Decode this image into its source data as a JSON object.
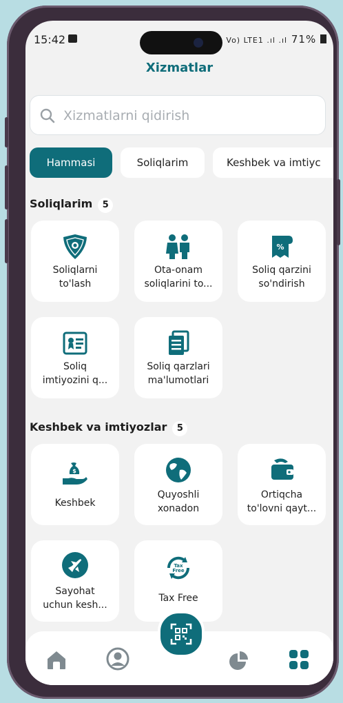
{
  "status": {
    "time": "15:42",
    "icons": "Vo) LTE1 .ıl .ıl",
    "battery": "71%"
  },
  "header": {
    "title": "Xizmatlar"
  },
  "search": {
    "placeholder": "Xizmatlarni qidirish"
  },
  "tabs": [
    {
      "label": "Hammasi",
      "active": true
    },
    {
      "label": "Soliqlarim",
      "active": false
    },
    {
      "label": "Keshbek va imtiyc",
      "active": false
    }
  ],
  "sections": [
    {
      "title": "Soliqlarim",
      "count": "5",
      "items": [
        {
          "line1": "Soliqlarni",
          "line2": "to'lash",
          "icon": "emblem-icon"
        },
        {
          "line1": "Ota-onam",
          "line2": "soliqlarini to...",
          "icon": "parents-icon"
        },
        {
          "line1": "Soliq qarzini",
          "line2": "so'ndirish",
          "icon": "receipt-percent-icon"
        },
        {
          "line1": "Soliq",
          "line2": "imtiyozini q...",
          "icon": "certificate-icon"
        },
        {
          "line1": "Soliq qarzlari",
          "line2": "ma'lumotlari",
          "icon": "documents-icon"
        }
      ]
    },
    {
      "title": "Keshbek va imtiyozlar",
      "count": "5",
      "items": [
        {
          "line1": "Keshbek",
          "line2": "",
          "icon": "money-hand-icon"
        },
        {
          "line1": "Quyoshli",
          "line2": "xonadon",
          "icon": "solar-globe-icon"
        },
        {
          "line1": "Ortiqcha",
          "line2": "to'lovni qayt...",
          "icon": "wallet-refund-icon"
        },
        {
          "line1": "Sayohat",
          "line2": "uchun kesh...",
          "icon": "plane-icon"
        },
        {
          "line1": "Tax Free",
          "line2": "",
          "icon": "tax-free-icon"
        }
      ]
    }
  ],
  "taxfree_badge": {
    "line1": "Tax",
    "line2": "Free"
  },
  "nav": [
    "home-icon",
    "profile-icon",
    "qr-scan-icon",
    "pie-chart-icon",
    "grid-icon"
  ],
  "colors": {
    "accent": "#0f6d7a",
    "background": "#f2f2f2"
  }
}
